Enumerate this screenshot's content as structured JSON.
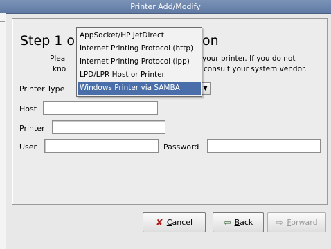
{
  "window": {
    "title": "Printer Add/Modify"
  },
  "step": {
    "heading_left": "Step 1 o",
    "heading_right": "on",
    "desc_line1_left": "Plea",
    "desc_line1_right": "your printer.  If you do not",
    "desc_line2_left": "kno",
    "desc_line2_right": "consult your system vendor."
  },
  "form": {
    "printer_type_label": "Printer Type",
    "host_label": "Host",
    "host_value": "",
    "printer_label": "Printer",
    "printer_value": "",
    "user_label": "User",
    "user_value": "",
    "password_label": "Password",
    "password_value": ""
  },
  "printer_type_options": [
    "AppSocket/HP JetDirect",
    "Internet Printing Protocol (http)",
    "Internet Printing Protocol (ipp)",
    "LPD/LPR Host or Printer",
    "Windows Printer via SAMBA"
  ],
  "selected_option": "Windows Printer via SAMBA",
  "buttons": {
    "cancel_mnemonic": "C",
    "cancel_rest": "ancel",
    "back_mnemonic": "B",
    "back_rest": "ack",
    "forward_mnemonic": "F",
    "forward_rest": "orward"
  },
  "icons": {
    "cancel": "x-icon",
    "back": "arrow-left-icon",
    "forward": "arrow-right-icon",
    "combo": "chevron-down-icon"
  },
  "colors": {
    "titlebar": "#6b85ad",
    "selection": "#4a6ea9"
  }
}
